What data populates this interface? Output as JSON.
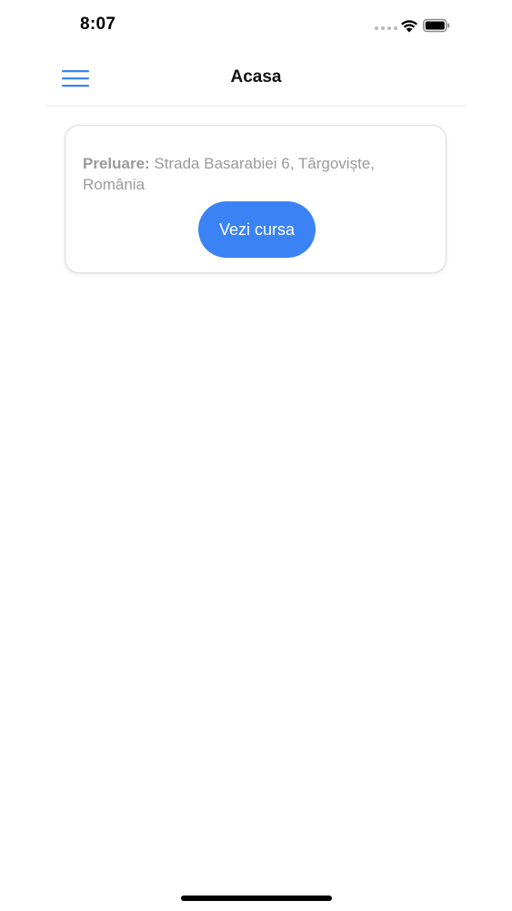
{
  "status_bar": {
    "time": "8:07",
    "icons": [
      "signal-dots-icon",
      "wifi-icon",
      "battery-icon"
    ]
  },
  "nav": {
    "title": "Acasa",
    "menu_icon": "hamburger-menu-icon"
  },
  "ride_card": {
    "pickup_label": "Preluare:",
    "pickup_address": " Strada Basarabiei 6, Târgoviște, România",
    "view_button_label": "Vezi cursa"
  },
  "colors": {
    "accent": "#3b83f5",
    "menu_icon": "#3b83f5",
    "muted_text": "#9a9a9a",
    "card_border": "#dcdcdc"
  }
}
